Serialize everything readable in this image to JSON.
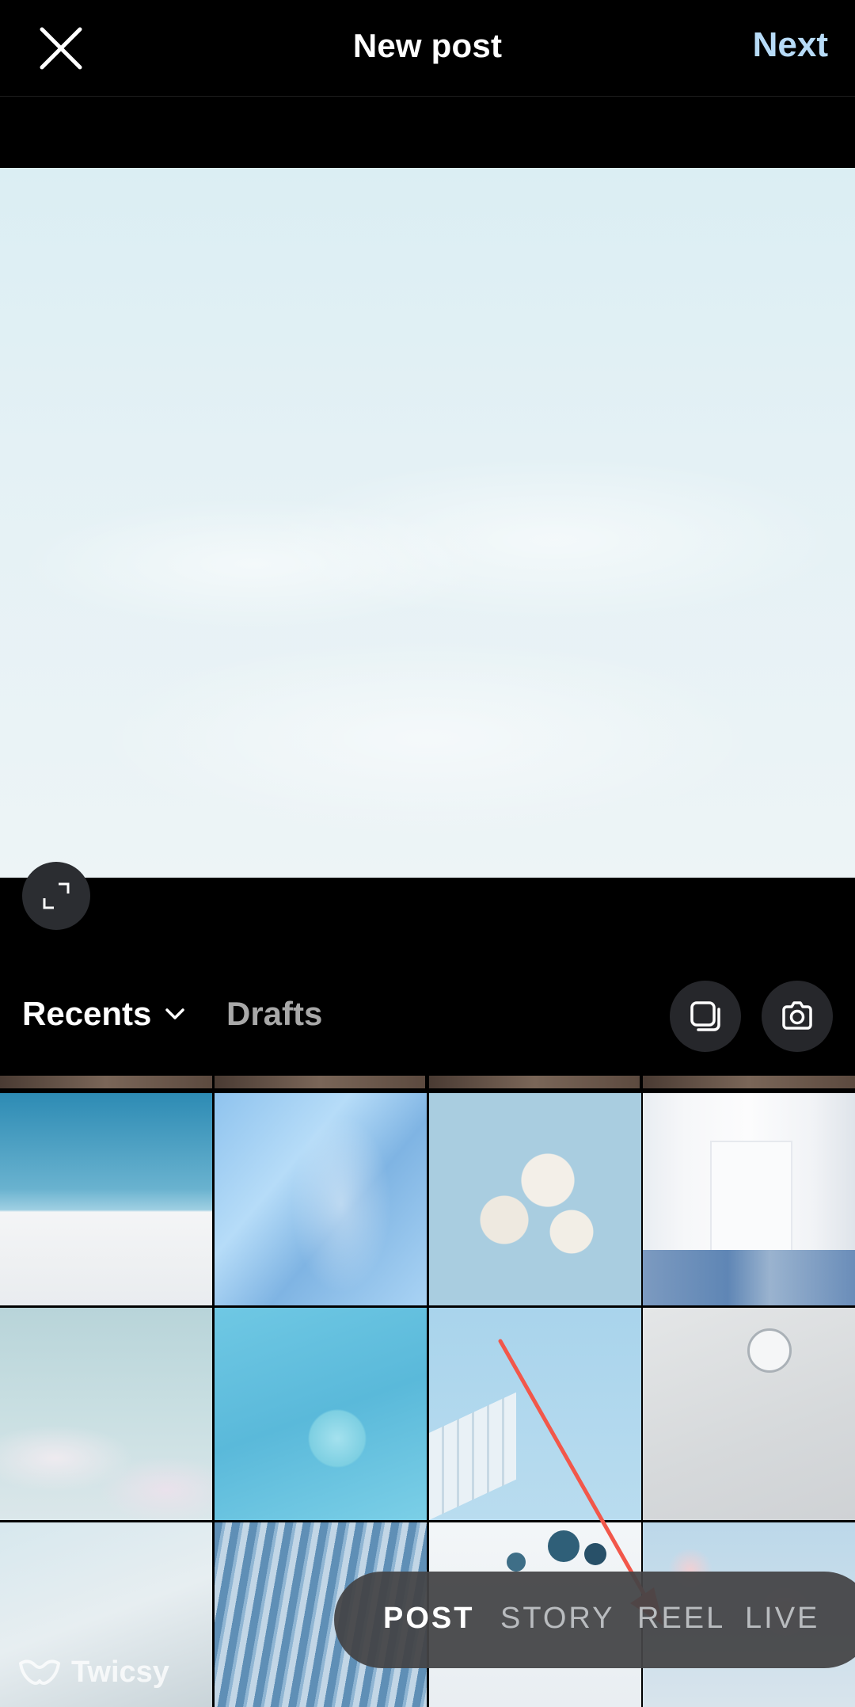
{
  "header": {
    "title": "New post",
    "next_label": "Next",
    "close_icon": "close-icon",
    "next_color": "#b7dbf7"
  },
  "preview": {
    "expand_icon": "expand-icon"
  },
  "toolbar": {
    "album_label": "Recents",
    "drafts_label": "Drafts",
    "multi_select_icon": "multi-select-icon",
    "camera_icon": "camera-icon"
  },
  "gallery": {
    "thumbnails": [
      "snowy-mountain",
      "blue-silk",
      "white-flowers",
      "white-hallway",
      "cloudy-sky",
      "teal-ball",
      "glass-building",
      "wall-clock",
      "white-arch",
      "tower-facade",
      "table-objects",
      "pink-blossom"
    ]
  },
  "modes": {
    "items": [
      "POST",
      "STORY",
      "REEL",
      "LIVE"
    ],
    "active": "POST"
  },
  "annotation": {
    "arrow_color": "#f2574a",
    "points_to": "REEL"
  },
  "watermark": {
    "text": "Twicsy"
  }
}
